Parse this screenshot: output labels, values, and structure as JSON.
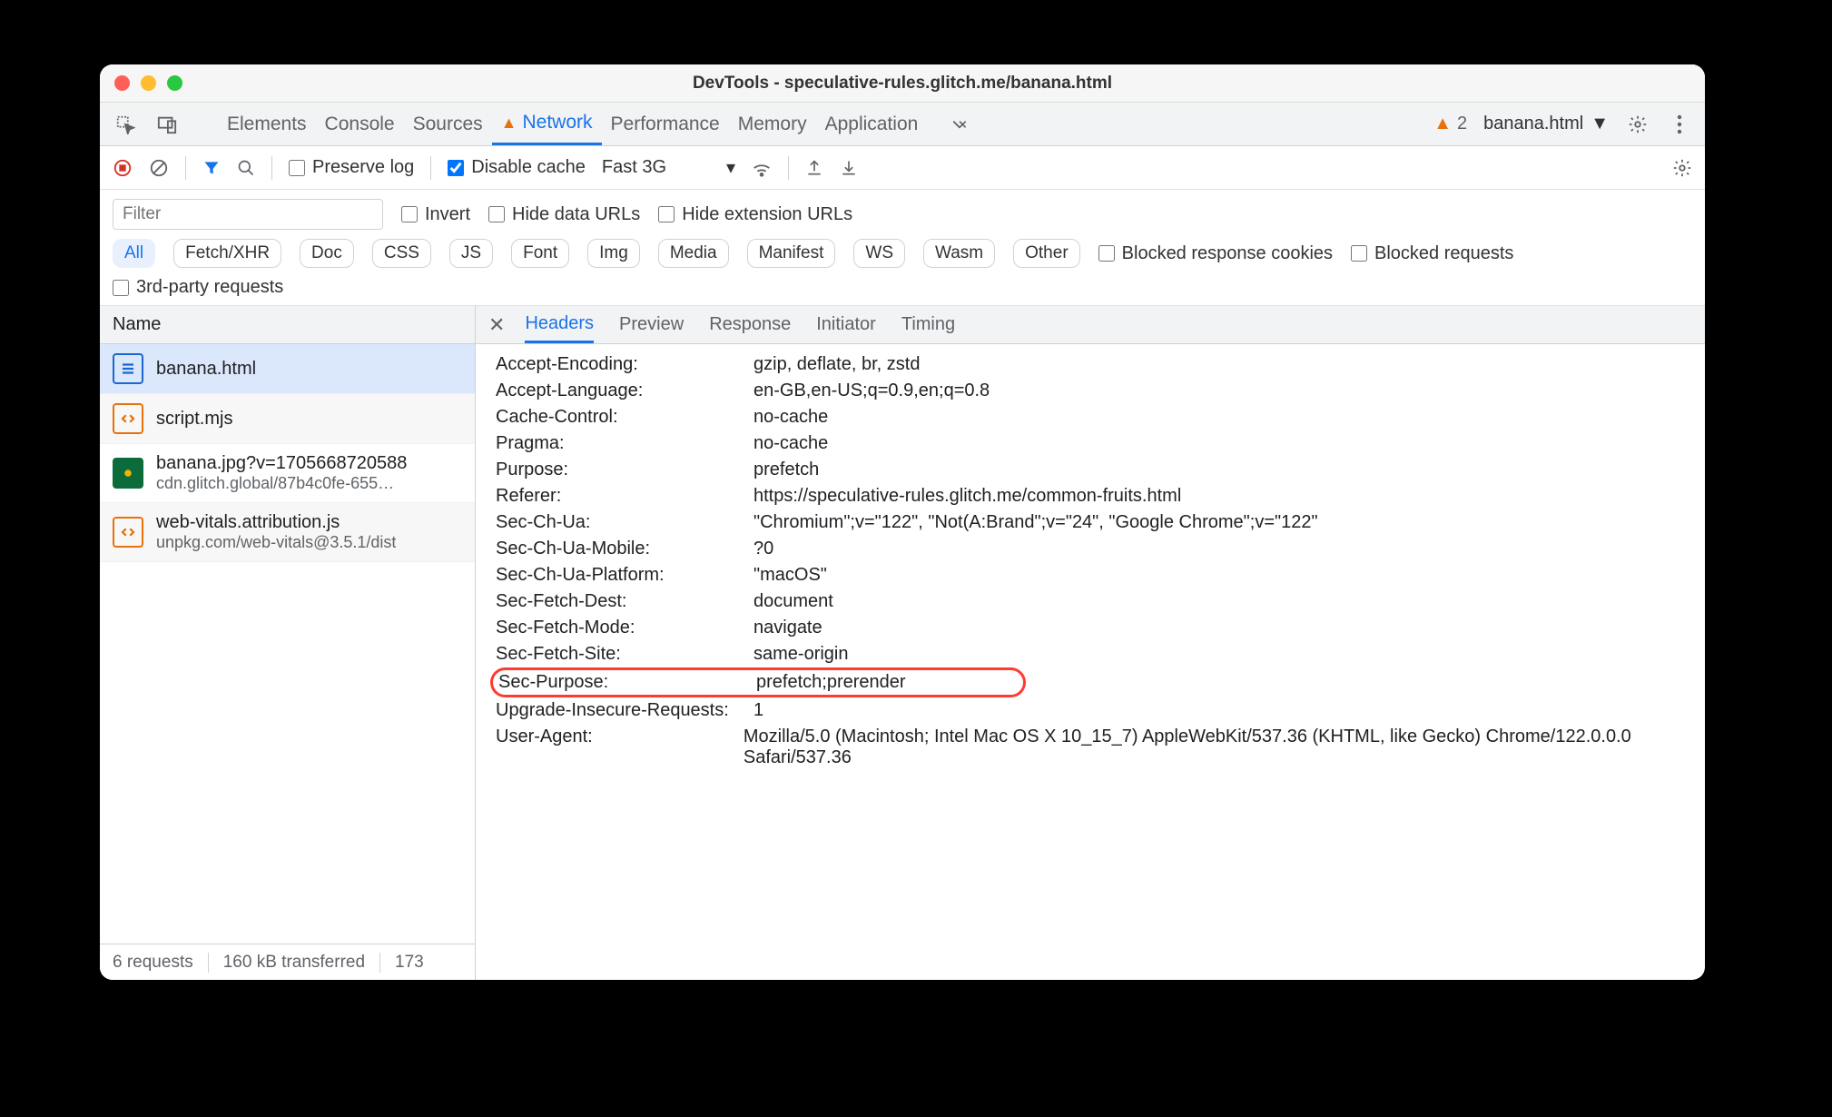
{
  "window": {
    "title": "DevTools - speculative-rules.glitch.me/banana.html"
  },
  "tabs": {
    "items": [
      "Elements",
      "Console",
      "Sources",
      "Network",
      "Performance",
      "Memory",
      "Application"
    ],
    "active_index": 3,
    "network_has_warning": true
  },
  "issues": {
    "count": "2"
  },
  "frame": {
    "label": "banana.html"
  },
  "toolbar": {
    "preserve_log": "Preserve log",
    "disable_cache": "Disable cache",
    "throttling": "Fast 3G"
  },
  "filters": {
    "placeholder": "Filter",
    "invert": "Invert",
    "hide_data_urls": "Hide data URLs",
    "hide_extension_urls": "Hide extension URLs",
    "chips": [
      "All",
      "Fetch/XHR",
      "Doc",
      "CSS",
      "JS",
      "Font",
      "Img",
      "Media",
      "Manifest",
      "WS",
      "Wasm",
      "Other"
    ],
    "chips_active_index": 0,
    "blocked_response_cookies": "Blocked response cookies",
    "blocked_requests": "Blocked requests",
    "third_party": "3rd-party requests"
  },
  "requests": {
    "column_header": "Name",
    "items": [
      {
        "name": "banana.html",
        "sub": "",
        "icon": "doc",
        "selected": true
      },
      {
        "name": "script.mjs",
        "sub": "",
        "icon": "js",
        "selected": false
      },
      {
        "name": "banana.jpg?v=1705668720588",
        "sub": "cdn.glitch.global/87b4c0fe-655…",
        "icon": "img",
        "selected": false
      },
      {
        "name": "web-vitals.attribution.js",
        "sub": "unpkg.com/web-vitals@3.5.1/dist",
        "icon": "js",
        "selected": false
      }
    ]
  },
  "status_bar": {
    "requests": "6 requests",
    "transferred": "160 kB transferred",
    "resources": "173"
  },
  "detail_tabs": {
    "items": [
      "Headers",
      "Preview",
      "Response",
      "Initiator",
      "Timing"
    ],
    "active_index": 0
  },
  "headers": [
    {
      "k": "Accept-Encoding:",
      "v": "gzip, deflate, br, zstd"
    },
    {
      "k": "Accept-Language:",
      "v": "en-GB,en-US;q=0.9,en;q=0.8"
    },
    {
      "k": "Cache-Control:",
      "v": "no-cache"
    },
    {
      "k": "Pragma:",
      "v": "no-cache"
    },
    {
      "k": "Purpose:",
      "v": "prefetch"
    },
    {
      "k": "Referer:",
      "v": "https://speculative-rules.glitch.me/common-fruits.html"
    },
    {
      "k": "Sec-Ch-Ua:",
      "v": "\"Chromium\";v=\"122\", \"Not(A:Brand\";v=\"24\", \"Google Chrome\";v=\"122\""
    },
    {
      "k": "Sec-Ch-Ua-Mobile:",
      "v": "?0"
    },
    {
      "k": "Sec-Ch-Ua-Platform:",
      "v": "\"macOS\""
    },
    {
      "k": "Sec-Fetch-Dest:",
      "v": "document"
    },
    {
      "k": "Sec-Fetch-Mode:",
      "v": "navigate"
    },
    {
      "k": "Sec-Fetch-Site:",
      "v": "same-origin"
    },
    {
      "k": "Sec-Purpose:",
      "v": "prefetch;prerender",
      "highlight": true
    },
    {
      "k": "Upgrade-Insecure-Requests:",
      "v": "1"
    },
    {
      "k": "User-Agent:",
      "v": "Mozilla/5.0 (Macintosh; Intel Mac OS X 10_15_7) AppleWebKit/537.36 (KHTML, like Gecko) Chrome/122.0.0.0 Safari/537.36"
    }
  ]
}
